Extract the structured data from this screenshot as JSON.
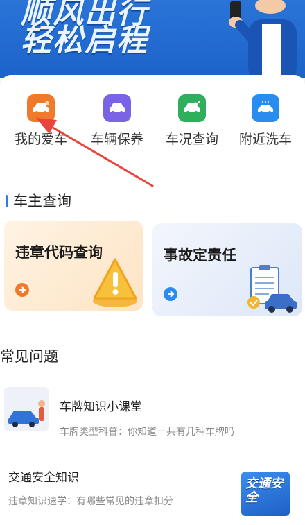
{
  "hero": {
    "line1": "顺风出行",
    "line2": "轻松启程"
  },
  "shortcuts": [
    {
      "label": "我的爱车",
      "icon": "car-icon",
      "color": "#f07a2b"
    },
    {
      "label": "车辆保养",
      "icon": "car-service-icon",
      "color": "#7b63e6"
    },
    {
      "label": "车况查询",
      "icon": "car-check-icon",
      "color": "#2fae5b"
    },
    {
      "label": "附近洗车",
      "icon": "car-wash-icon",
      "color": "#2b8cf0"
    }
  ],
  "owner_section": {
    "title": "车主查询"
  },
  "cards": [
    {
      "title": "违章代码查询",
      "arrow_color": "#f07a2b"
    },
    {
      "title": "事故定责任",
      "arrow_color": "#2b8cf0"
    }
  ],
  "faq_section": {
    "title": "常见问题"
  },
  "faq": [
    {
      "title": "车牌知识小课堂",
      "desc": "车牌类型科普：你知道一共有几种车牌吗"
    },
    {
      "title": "交通安全知识",
      "desc": "违章知识速学：有哪些常见的违章扣分",
      "thumb_text": "交通安全"
    }
  ],
  "colors": {
    "accent": "#2b7cf0",
    "annotation": "#e8453c"
  }
}
